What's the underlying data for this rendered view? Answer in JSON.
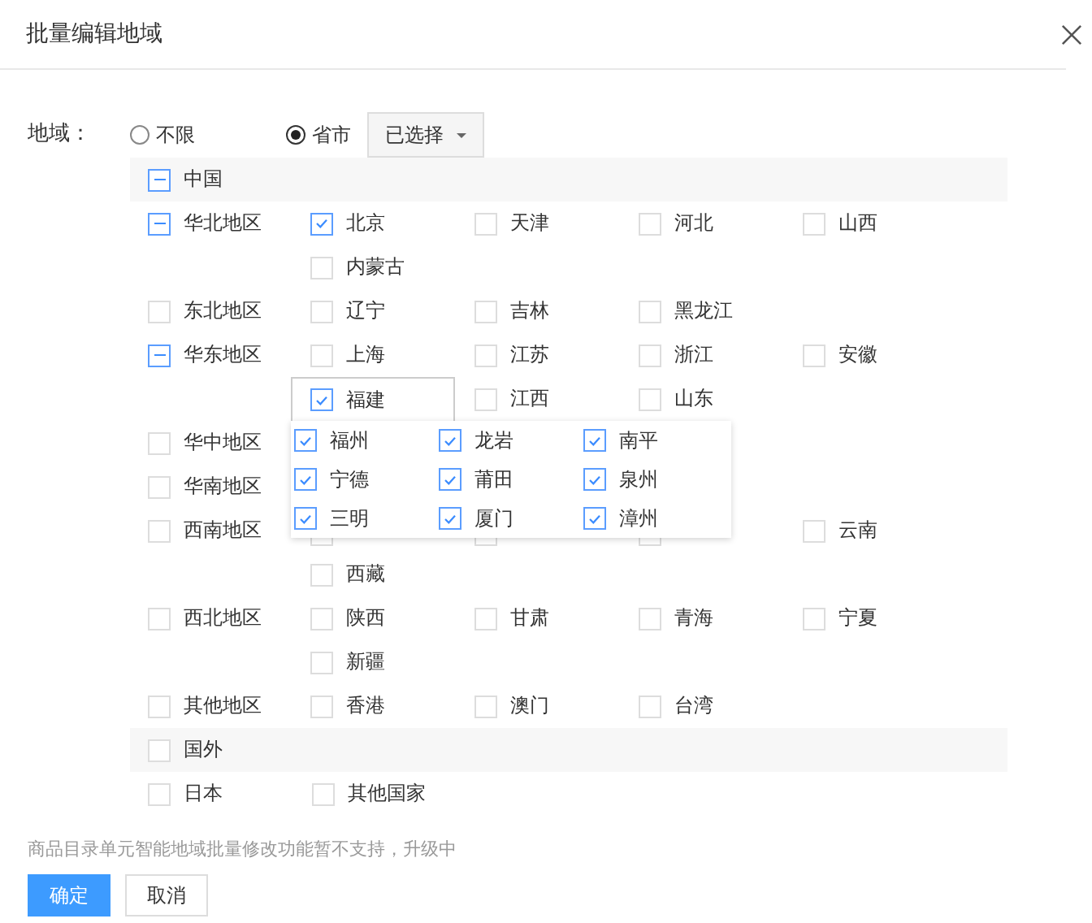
{
  "dialog": {
    "title": "批量编辑地域"
  },
  "field_label": "地域：",
  "scope_options": [
    {
      "label": "不限",
      "selected": false
    },
    {
      "label": "省市",
      "selected": true
    }
  ],
  "selector_button": "已选择",
  "groups": [
    {
      "name": "中国",
      "partial": true,
      "regions": [
        {
          "name": "华北地区",
          "partial": true,
          "provinces": [
            {
              "name": "北京",
              "checked": true
            },
            {
              "name": "天津",
              "checked": false
            },
            {
              "name": "河北",
              "checked": false
            },
            {
              "name": "山西",
              "checked": false
            },
            {
              "name": "内蒙古",
              "checked": false
            }
          ]
        },
        {
          "name": "东北地区",
          "partial": false,
          "provinces": [
            {
              "name": "辽宁",
              "checked": false
            },
            {
              "name": "吉林",
              "checked": false
            },
            {
              "name": "黑龙江",
              "checked": false
            }
          ]
        },
        {
          "name": "华东地区",
          "partial": true,
          "provinces": [
            {
              "name": "上海",
              "checked": false
            },
            {
              "name": "江苏",
              "checked": false
            },
            {
              "name": "浙江",
              "checked": false
            },
            {
              "name": "安徽",
              "checked": false
            },
            {
              "name": "福建",
              "checked": true,
              "expanded": true,
              "cities": [
                {
                  "name": "福州",
                  "checked": true
                },
                {
                  "name": "龙岩",
                  "checked": true
                },
                {
                  "name": "南平",
                  "checked": true
                },
                {
                  "name": "宁德",
                  "checked": true
                },
                {
                  "name": "莆田",
                  "checked": true
                },
                {
                  "name": "泉州",
                  "checked": true
                },
                {
                  "name": "三明",
                  "checked": true
                },
                {
                  "name": "厦门",
                  "checked": true
                },
                {
                  "name": "漳州",
                  "checked": true
                }
              ]
            },
            {
              "name": "江西",
              "checked": false
            },
            {
              "name": "山东",
              "checked": false
            }
          ]
        },
        {
          "name": "华中地区",
          "partial": false
        },
        {
          "name": "华南地区",
          "partial": false
        },
        {
          "name": "西南地区",
          "partial": false,
          "provinces": [
            {
              "covered": true
            },
            {
              "covered": true
            },
            {
              "covered": true
            },
            {
              "name": "云南",
              "checked": false
            },
            {
              "name": "西藏",
              "checked": false
            }
          ]
        },
        {
          "name": "西北地区",
          "partial": false,
          "provinces": [
            {
              "name": "陕西",
              "checked": false
            },
            {
              "name": "甘肃",
              "checked": false
            },
            {
              "name": "青海",
              "checked": false
            },
            {
              "name": "宁夏",
              "checked": false
            },
            {
              "name": "新疆",
              "checked": false
            }
          ]
        },
        {
          "name": "其他地区",
          "partial": false,
          "provinces": [
            {
              "name": "香港",
              "checked": false
            },
            {
              "name": "澳门",
              "checked": false
            },
            {
              "name": "台湾",
              "checked": false
            }
          ]
        }
      ]
    },
    {
      "name": "国外",
      "partial": false,
      "items": [
        {
          "name": "日本",
          "checked": false
        },
        {
          "name": "其他国家",
          "checked": false
        }
      ]
    }
  ],
  "note": "商品目录单元智能地域批量修改功能暂不支持，升级中",
  "buttons": [
    {
      "label": "确定",
      "kind": "primary"
    },
    {
      "label": "取消",
      "kind": "default"
    }
  ]
}
